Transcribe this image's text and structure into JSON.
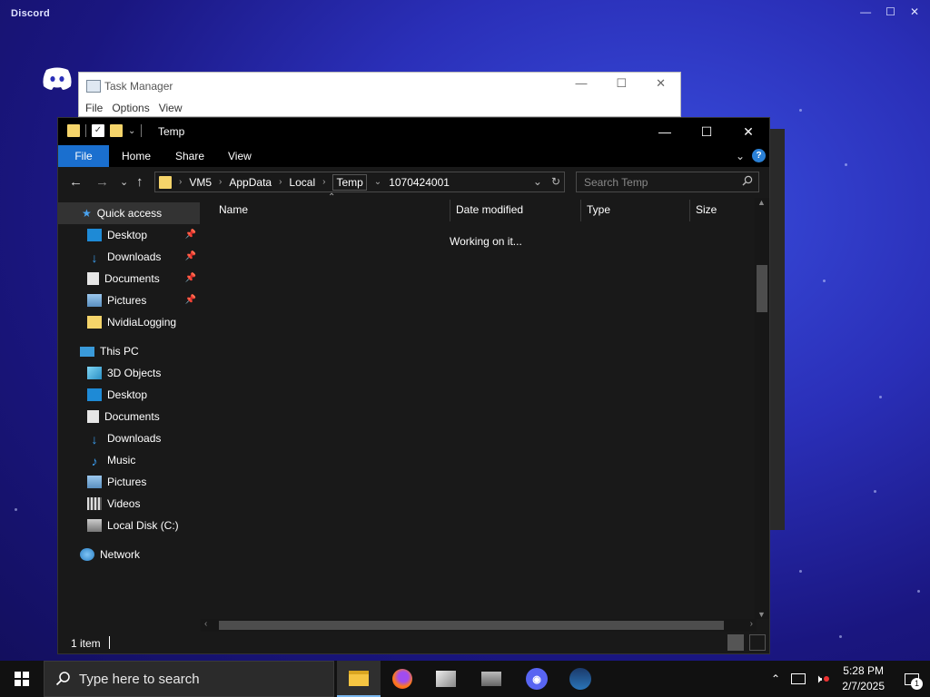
{
  "discord": {
    "title": "Discord",
    "minimize": "—",
    "maximize": "☐",
    "close": "✕"
  },
  "task_manager": {
    "title": "Task Manager",
    "menu": [
      "File",
      "Options",
      "View"
    ],
    "minimize": "—",
    "maximize": "☐",
    "close": "✕"
  },
  "explorer": {
    "title": "Temp",
    "minimize": "—",
    "maximize": "☐",
    "close": "✕",
    "ribbon": {
      "file": "File",
      "tabs": [
        "Home",
        "Share",
        "View"
      ],
      "expand": "⌄",
      "help": "?"
    },
    "nav": {
      "back": "←",
      "forward": "→",
      "recent": "⌄",
      "up": "↑"
    },
    "address": {
      "crumbs": [
        "VM5",
        "AppData",
        "Local",
        "Temp",
        "1070424001"
      ],
      "sep": "›",
      "dropdown": "⌄",
      "refresh": "↻"
    },
    "search_placeholder": "Search Temp",
    "sidebar": {
      "quick_access": "Quick access",
      "quick_items": [
        {
          "label": "Desktop",
          "pinned": true
        },
        {
          "label": "Downloads",
          "pinned": true
        },
        {
          "label": "Documents",
          "pinned": true
        },
        {
          "label": "Pictures",
          "pinned": true
        },
        {
          "label": "NvidiaLogging",
          "pinned": false
        }
      ],
      "this_pc": "This PC",
      "pc_items": [
        "3D Objects",
        "Desktop",
        "Documents",
        "Downloads",
        "Music",
        "Pictures",
        "Videos",
        "Local Disk (C:)"
      ],
      "network": "Network",
      "pin_glyph": "📌"
    },
    "columns": [
      "Name",
      "Date modified",
      "Type",
      "Size"
    ],
    "sort_glyph": "⌃",
    "working_text": "Working on it...",
    "status": "1 item"
  },
  "taskbar": {
    "search_placeholder": "Type here to search",
    "time": "5:28 PM",
    "date": "2/7/2025",
    "notification_count": "1",
    "tray_up": "⌃"
  }
}
